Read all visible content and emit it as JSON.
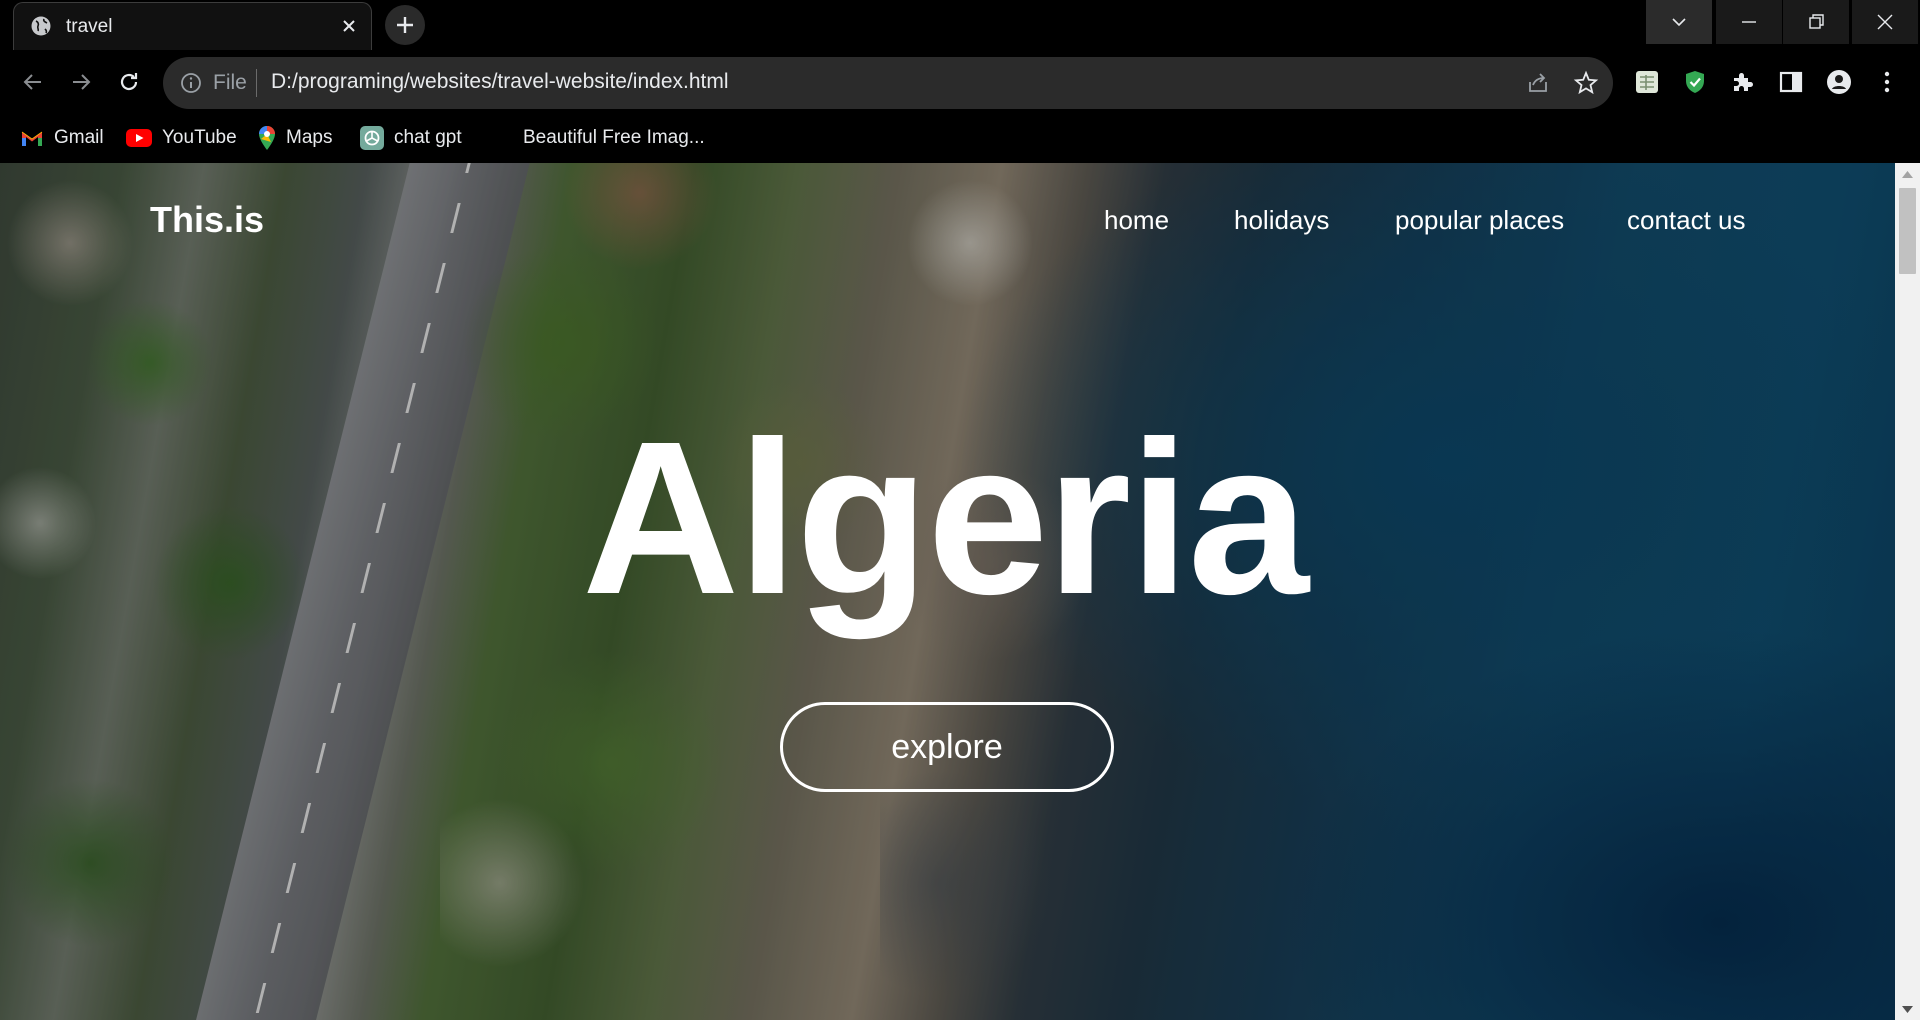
{
  "browser": {
    "tab": {
      "title": "travel"
    },
    "address_bar": {
      "scheme_label": "File",
      "url": "D:/programing/websites/travel-website/index.html"
    },
    "bookmarks": [
      {
        "label": "Gmail",
        "icon": "gmail-icon"
      },
      {
        "label": "YouTube",
        "icon": "youtube-icon"
      },
      {
        "label": "Maps",
        "icon": "maps-icon"
      },
      {
        "label": "chat gpt",
        "icon": "chatgpt-icon"
      },
      {
        "label": "Beautiful Free Imag...",
        "icon": "none"
      }
    ],
    "extensions": [
      "sheets-icon",
      "shield-check-icon",
      "puzzle-icon",
      "side-panel-icon",
      "profile-icon",
      "kebab-menu-icon"
    ]
  },
  "page": {
    "logo": "This.is",
    "nav": {
      "home": "home",
      "holidays": "holidays",
      "popular_places": "popular places",
      "contact_us": "contact us"
    },
    "hero": {
      "title": "Algeria",
      "button": "explore"
    },
    "background": "aerial coastal photo"
  },
  "colors": {
    "chrome_bg": "#000000",
    "omnibox_bg": "#2b2b2b",
    "chrome_text": "#e8eaed",
    "page_text": "#ffffff",
    "shield_green": "#34a853"
  }
}
